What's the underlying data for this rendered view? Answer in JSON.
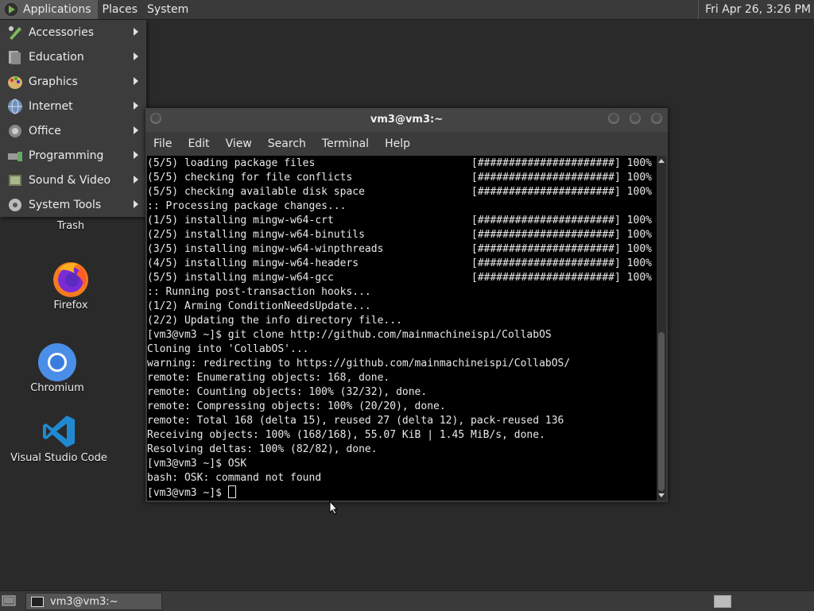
{
  "top_panel": {
    "applications": "Applications",
    "places": "Places",
    "system": "System",
    "clock": "Fri Apr 26,  3:26 PM"
  },
  "apps_menu": {
    "items": [
      {
        "label": "Accessories",
        "icon": "accessories-icon"
      },
      {
        "label": "Education",
        "icon": "education-icon"
      },
      {
        "label": "Graphics",
        "icon": "graphics-icon"
      },
      {
        "label": "Internet",
        "icon": "internet-icon"
      },
      {
        "label": "Office",
        "icon": "office-icon"
      },
      {
        "label": "Programming",
        "icon": "programming-icon"
      },
      {
        "label": "Sound & Video",
        "icon": "sound-video-icon"
      },
      {
        "label": "System Tools",
        "icon": "system-tools-icon"
      }
    ]
  },
  "desktop": {
    "icons": [
      {
        "label": "Trash",
        "icon": "trash-icon"
      },
      {
        "label": "Firefox",
        "icon": "firefox-icon"
      },
      {
        "label": "Chromium",
        "icon": "chromium-icon"
      },
      {
        "label": "Visual Studio Code",
        "icon": "vscode-icon"
      }
    ]
  },
  "terminal": {
    "title": "vm3@vm3:~",
    "menu": [
      "File",
      "Edit",
      "View",
      "Search",
      "Terminal",
      "Help"
    ],
    "lines": [
      {
        "text": "(5/5) loading package files",
        "progress": "[######################] 100%"
      },
      {
        "text": "(5/5) checking for file conflicts",
        "progress": "[######################] 100%"
      },
      {
        "text": "(5/5) checking available disk space",
        "progress": "[######################] 100%"
      },
      {
        "text": ":: Processing package changes...",
        "progress": ""
      },
      {
        "text": "(1/5) installing mingw-w64-crt",
        "progress": "[######################] 100%"
      },
      {
        "text": "(2/5) installing mingw-w64-binutils",
        "progress": "[######################] 100%"
      },
      {
        "text": "(3/5) installing mingw-w64-winpthreads",
        "progress": "[######################] 100%"
      },
      {
        "text": "(4/5) installing mingw-w64-headers",
        "progress": "[######################] 100%"
      },
      {
        "text": "(5/5) installing mingw-w64-gcc",
        "progress": "[######################] 100%"
      },
      {
        "text": ":: Running post-transaction hooks...",
        "progress": ""
      },
      {
        "text": "(1/2) Arming ConditionNeedsUpdate...",
        "progress": ""
      },
      {
        "text": "(2/2) Updating the info directory file...",
        "progress": ""
      },
      {
        "text": "[vm3@vm3 ~]$ git clone http://github.com/mainmachineispi/CollabOS",
        "progress": ""
      },
      {
        "text": "Cloning into 'CollabOS'...",
        "progress": ""
      },
      {
        "text": "warning: redirecting to https://github.com/mainmachineispi/CollabOS/",
        "progress": ""
      },
      {
        "text": "remote: Enumerating objects: 168, done.",
        "progress": ""
      },
      {
        "text": "remote: Counting objects: 100% (32/32), done.",
        "progress": ""
      },
      {
        "text": "remote: Compressing objects: 100% (20/20), done.",
        "progress": ""
      },
      {
        "text": "remote: Total 168 (delta 15), reused 27 (delta 12), pack-reused 136",
        "progress": ""
      },
      {
        "text": "Receiving objects: 100% (168/168), 55.07 KiB | 1.45 MiB/s, done.",
        "progress": ""
      },
      {
        "text": "Resolving deltas: 100% (82/82), done.",
        "progress": ""
      },
      {
        "text": "[vm3@vm3 ~]$ OSK",
        "progress": ""
      },
      {
        "text": "bash: OSK: command not found",
        "progress": ""
      }
    ],
    "prompt": "[vm3@vm3 ~]$ "
  },
  "taskbar": {
    "window_label": "vm3@vm3:~"
  }
}
